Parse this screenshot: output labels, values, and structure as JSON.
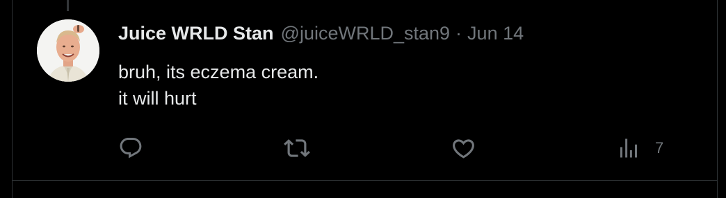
{
  "tweet": {
    "display_name": "Juice WRLD Stan",
    "handle": "@juiceWRLD_stan9",
    "separator": "·",
    "date": "Jun 14",
    "text_lines": [
      "bruh, its eczema cream.",
      "it will hurt"
    ]
  },
  "actions": {
    "reply_icon": "reply-icon",
    "retweet_icon": "retweet-icon",
    "like_icon": "heart-icon",
    "views_icon": "views-icon",
    "views_count": "7"
  },
  "colors": {
    "background": "#000000",
    "primary_text": "#e7e9ea",
    "secondary_text": "#71767b",
    "border": "#2f3336"
  }
}
